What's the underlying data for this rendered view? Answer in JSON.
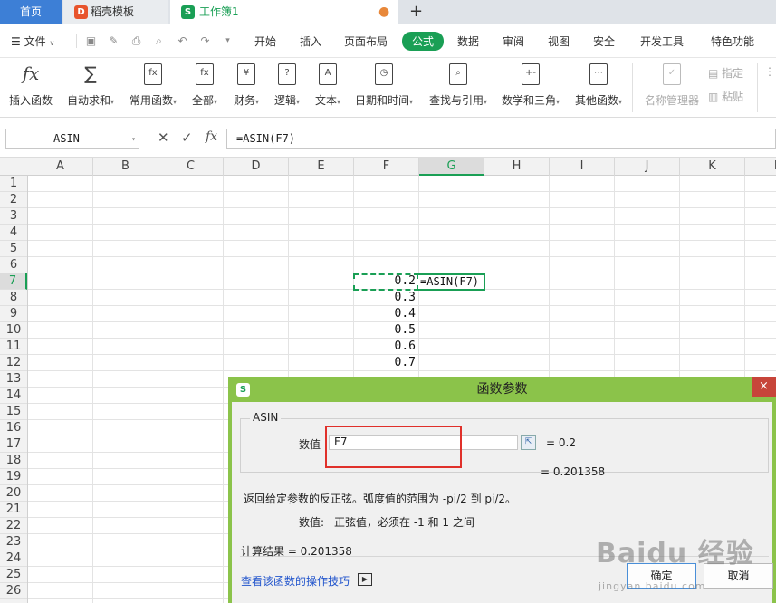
{
  "tabs": {
    "home": "首页",
    "template": "稻壳模板",
    "workbook": "工作簿1",
    "new_tab": "+"
  },
  "menu": {
    "file": "文件",
    "items": [
      "开始",
      "插入",
      "页面布局",
      "公式",
      "数据",
      "审阅",
      "视图",
      "安全",
      "开发工具",
      "特色功能"
    ],
    "active": "公式"
  },
  "ribbon": {
    "insert_func": "插入函数",
    "autosum": "自动求和",
    "common": "常用函数",
    "all": "全部",
    "finance": "财务",
    "logic": "逻辑",
    "text": "文本",
    "datetime": "日期和时间",
    "lookup": "查找与引用",
    "math": "数学和三角",
    "other": "其他函数",
    "name_mgr": "名称管理器",
    "specify": "指定",
    "paste": "粘贴"
  },
  "formula_bar": {
    "name_box": "ASIN",
    "fx": "fx",
    "formula": "=ASIN(F7)"
  },
  "grid": {
    "columns": [
      "A",
      "B",
      "C",
      "D",
      "E",
      "F",
      "G",
      "H",
      "I",
      "J",
      "K",
      "L"
    ],
    "rows": [
      "1",
      "2",
      "3",
      "4",
      "5",
      "6",
      "7",
      "8",
      "9",
      "10",
      "11",
      "12",
      "13",
      "14",
      "15",
      "16",
      "17",
      "18",
      "19",
      "20",
      "21",
      "22",
      "23",
      "24",
      "25",
      "26"
    ],
    "f_values": [
      "0.2",
      "0.3",
      "0.4",
      "0.5",
      "0.6",
      "0.7"
    ],
    "g7_edit": "=ASIN(F7)"
  },
  "dialog": {
    "title": "函数参数",
    "close": "×",
    "function_name": "ASIN",
    "arg_label": "数值",
    "arg_value": "F7",
    "arg_result": "=  0.2",
    "func_result": "=  0.201358",
    "description": "返回给定参数的反正弦。弧度值的范围为 -pi/2 到 pi/2。",
    "arg_desc_label": "数值:",
    "arg_desc": "正弦值，必须在 -1 和 1 之间",
    "calc_result": "计算结果  =  0.201358",
    "help_link": "查看该函数的操作技巧",
    "ok": "确定",
    "cancel": "取消"
  },
  "watermark": {
    "brand": "Baidu 经验",
    "url": "jingyan.baidu.com"
  }
}
